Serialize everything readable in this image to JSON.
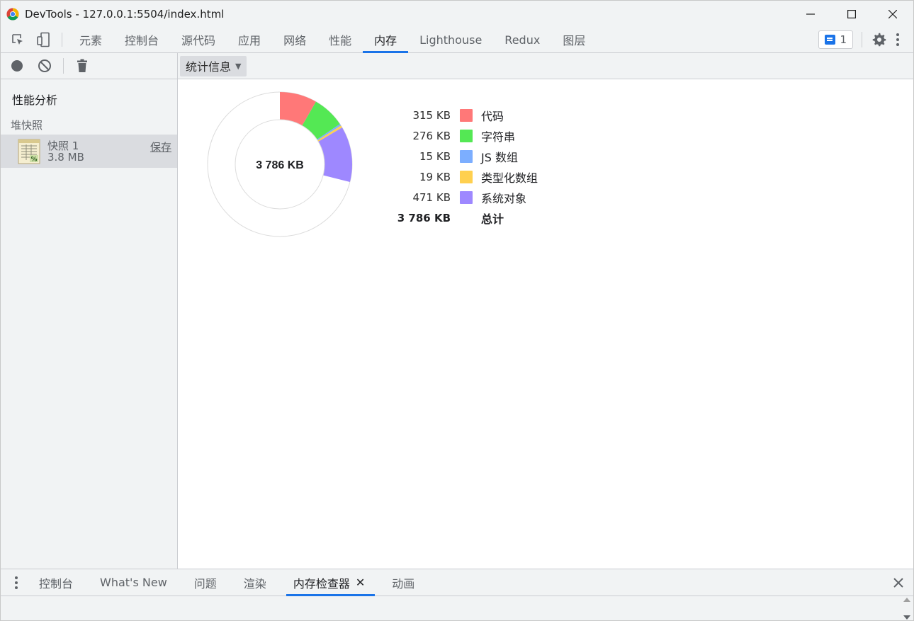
{
  "window": {
    "title": "DevTools - 127.0.0.1:5504/index.html"
  },
  "toolbar": {
    "tabs": [
      {
        "label": "元素",
        "active": false
      },
      {
        "label": "控制台",
        "active": false
      },
      {
        "label": "源代码",
        "active": false
      },
      {
        "label": "应用",
        "active": false
      },
      {
        "label": "网络",
        "active": false
      },
      {
        "label": "性能",
        "active": false
      },
      {
        "label": "内存",
        "active": true
      },
      {
        "label": "Lighthouse",
        "active": false
      },
      {
        "label": "Redux",
        "active": false
      },
      {
        "label": "图层",
        "active": false
      }
    ],
    "issues_count": "1"
  },
  "sidebar": {
    "heading": "性能分析",
    "subheading": "堆快照",
    "snapshot": {
      "name": "快照 1",
      "size": "3.8 MB",
      "save_label": "保存"
    }
  },
  "content": {
    "view_select": "统计信息",
    "total_center": "3 786 KB"
  },
  "legend": [
    {
      "value": "315 KB",
      "label": "代码",
      "color": "#ff7878"
    },
    {
      "value": "276 KB",
      "label": "字符串",
      "color": "#54e854"
    },
    {
      "value": "15 KB",
      "label": "JS 数组",
      "color": "#7caeff"
    },
    {
      "value": "19 KB",
      "label": "类型化数组",
      "color": "#ffd04f"
    },
    {
      "value": "471 KB",
      "label": "系统对象",
      "color": "#9e88ff"
    }
  ],
  "total": {
    "value": "3 786 KB",
    "label": "总计"
  },
  "chart_data": {
    "type": "pie",
    "categories": [
      "代码",
      "字符串",
      "JS 数组",
      "类型化数组",
      "系统对象"
    ],
    "values": [
      315,
      276,
      15,
      19,
      471
    ],
    "total": 3786,
    "unit": "KB",
    "colors": [
      "#ff7878",
      "#54e854",
      "#7caeff",
      "#ffd04f",
      "#9e88ff"
    ]
  },
  "drawer": {
    "tabs": [
      {
        "label": "控制台",
        "active": false
      },
      {
        "label": "What's New",
        "active": false
      },
      {
        "label": "问题",
        "active": false
      },
      {
        "label": "渲染",
        "active": false
      },
      {
        "label": "内存检查器",
        "active": true,
        "closable": true
      },
      {
        "label": "动画",
        "active": false
      }
    ]
  }
}
